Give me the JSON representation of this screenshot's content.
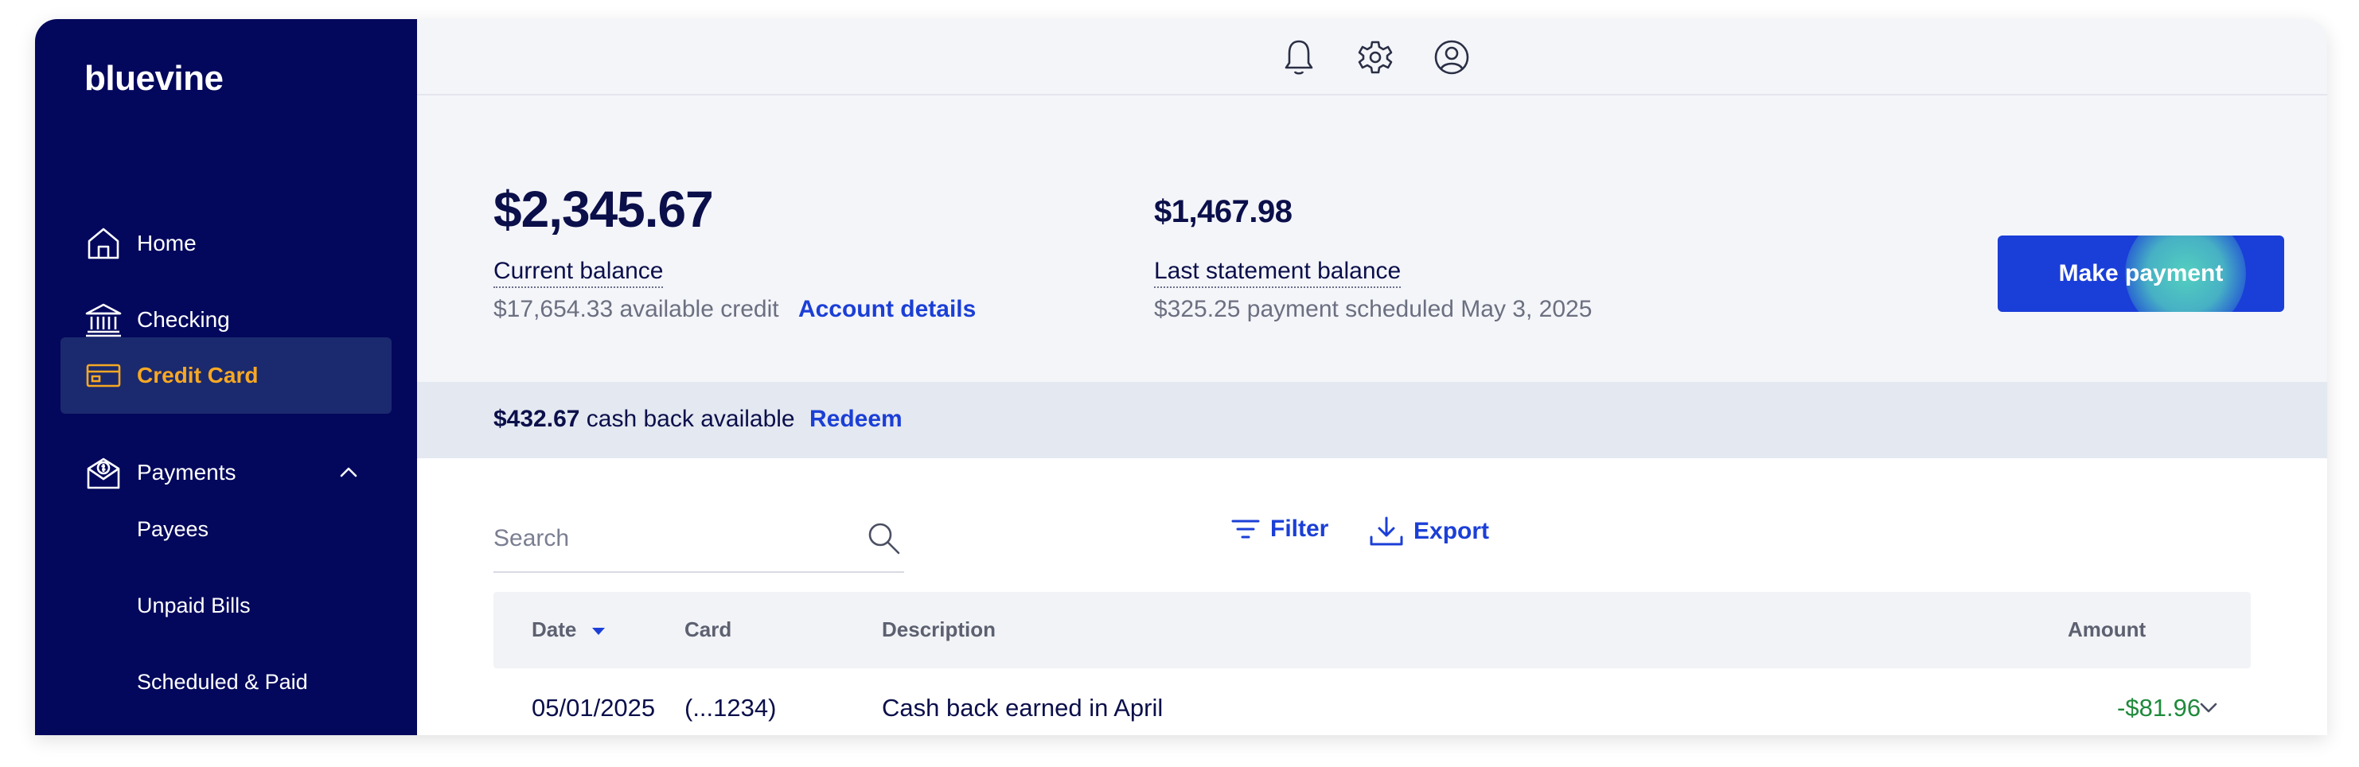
{
  "brand": {
    "logo": "bluevine"
  },
  "sidebar": {
    "items": [
      {
        "label": "Home",
        "icon": "home-icon"
      },
      {
        "label": "Checking",
        "icon": "bank-icon"
      },
      {
        "label": "Credit Card",
        "icon": "credit-card-icon",
        "active": true
      },
      {
        "label": "Payments",
        "icon": "payments-icon",
        "expanded": true
      }
    ],
    "sub_items": [
      {
        "label": "Payees"
      },
      {
        "label": "Unpaid Bills"
      },
      {
        "label": "Scheduled & Paid"
      }
    ]
  },
  "topbar": {
    "icons": [
      "bell-icon",
      "gear-icon",
      "account-icon"
    ]
  },
  "summary": {
    "current_balance": "$2,345.67",
    "current_balance_label": "Current balance",
    "available_credit": "$17,654.33 available credit",
    "account_details_link": "Account details",
    "statement_balance": "$1,467.98",
    "statement_balance_label": "Last statement balance",
    "payment_scheduled": "$325.25 payment scheduled May 3, 2025",
    "make_payment_label": "Make payment"
  },
  "cashback": {
    "amount": "$432.67",
    "text": " cash back available",
    "redeem_link": "Redeem"
  },
  "toolbar": {
    "search_placeholder": "Search",
    "filter_label": "Filter",
    "export_label": "Export"
  },
  "table": {
    "columns": [
      "Date",
      "Card",
      "Description",
      "Amount"
    ],
    "sort_column": "Date",
    "sort_direction": "descending",
    "rows": [
      {
        "date": "05/01/2025",
        "card": "(...1234)",
        "description": "Cash back earned in April",
        "amount": "-$81.96"
      }
    ]
  },
  "colors": {
    "sidebar_bg": "#03085c",
    "active_item_bg": "#1b2a6e",
    "active_item_text": "#f7a823",
    "primary_button": "#1a3ed8",
    "link": "#1b3fd6",
    "positive_amount": "#1f8a3c",
    "click_highlight": "#56d7be"
  }
}
